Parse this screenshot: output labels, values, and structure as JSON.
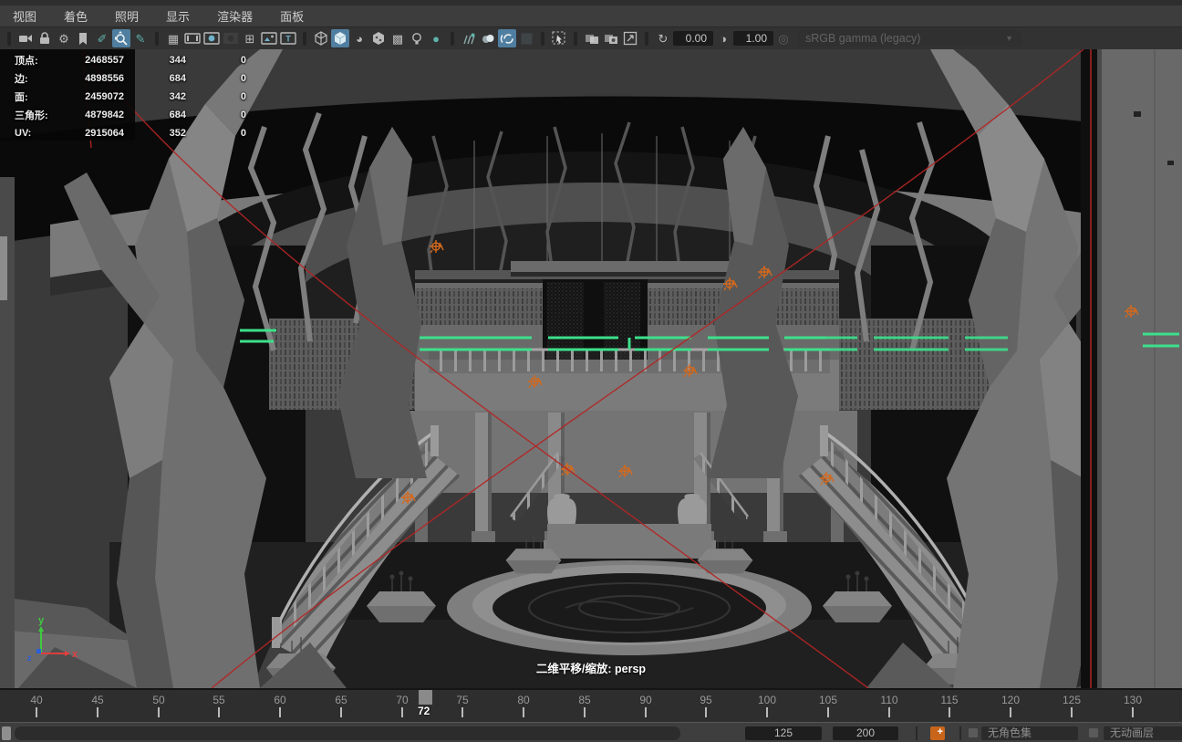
{
  "menu_bar": {
    "items": [
      "视图",
      "着色",
      "照明",
      "显示",
      "渲染器",
      "面板"
    ]
  },
  "toolbar": {
    "exposure_value": "0.00",
    "gamma_value": "1.00",
    "colorspace": "sRGB gamma (legacy)"
  },
  "icons": {
    "gear": "⚙",
    "pan_tool": "✐",
    "pencil": "✎",
    "grid": "▦",
    "field_chart": "⊞",
    "checker": "▩",
    "flat_shade": "◕",
    "default_light": "●",
    "exposure": "↻",
    "contrast": "◑",
    "gamma": "◎",
    "caret": "▼",
    "plus": "+"
  },
  "hud": {
    "rows": [
      {
        "label": "顶点:",
        "col1": "2468557",
        "col2": "344",
        "col3": "0"
      },
      {
        "label": "边:",
        "col1": "4898556",
        "col2": "684",
        "col3": "0"
      },
      {
        "label": "面:",
        "col1": "2459072",
        "col2": "342",
        "col3": "0"
      },
      {
        "label": "三角形:",
        "col1": "4879842",
        "col2": "684",
        "col3": "0"
      },
      {
        "label": "UV:",
        "col1": "2915064",
        "col2": "352",
        "col3": "0"
      }
    ]
  },
  "viewport": {
    "status_label": "二维平移/缩放: persp",
    "axis": {
      "x": "x",
      "y": "y",
      "z": "z"
    },
    "selection_color": "#3de08b",
    "overlay_color": "#b42525",
    "highlight_color": "#d2691e"
  },
  "timeline": {
    "ticks": [
      "40",
      "45",
      "50",
      "55",
      "60",
      "65",
      "70",
      "75",
      "80",
      "85",
      "90",
      "95",
      "100",
      "105",
      "110",
      "115",
      "120",
      "125",
      "130"
    ],
    "current_frame": "72"
  },
  "range_bar": {
    "field_a": "125",
    "field_b": "200",
    "character_set": "无角色集",
    "anim_layer": "无动画层"
  }
}
